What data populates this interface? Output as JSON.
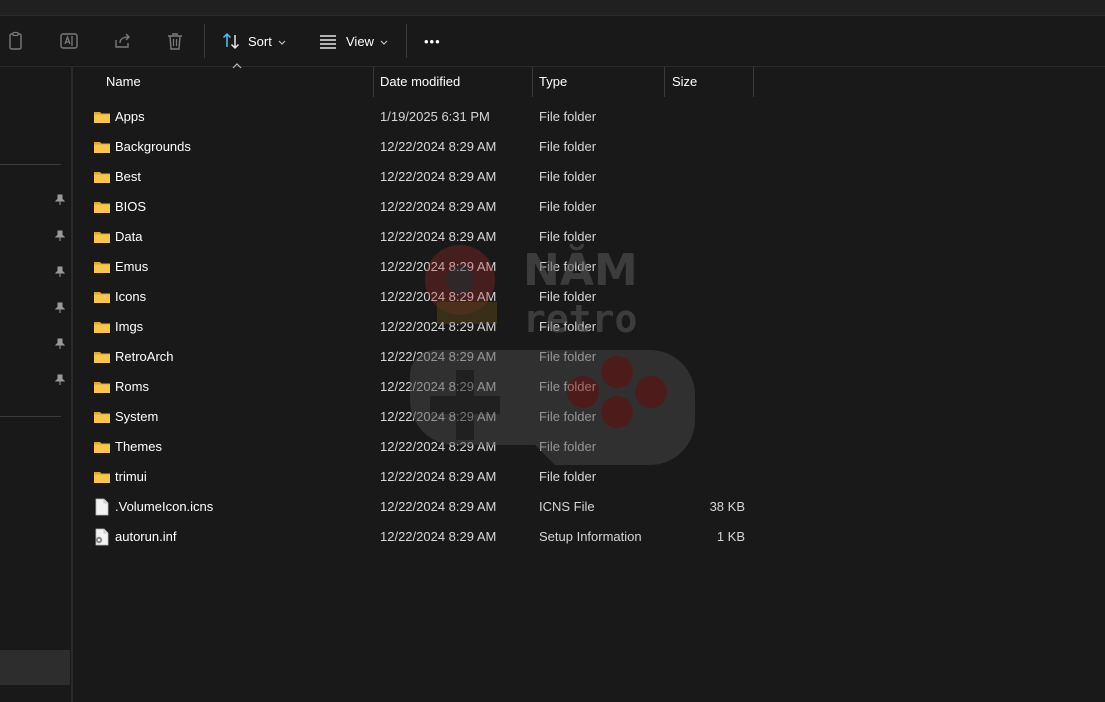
{
  "toolbar": {
    "copy_icon": "clipboard-icon",
    "rename_icon": "rename-icon",
    "share_icon": "share-icon",
    "delete_icon": "trash-icon",
    "sort_label": "Sort",
    "view_label": "View",
    "more_label": "•••"
  },
  "columns": {
    "name": "Name",
    "date": "Date modified",
    "type": "Type",
    "size": "Size"
  },
  "files": [
    {
      "name": "Apps",
      "date": "1/19/2025 6:31 PM",
      "type": "File folder",
      "size": "",
      "icon": "folder-icon"
    },
    {
      "name": "Backgrounds",
      "date": "12/22/2024 8:29 AM",
      "type": "File folder",
      "size": "",
      "icon": "folder-icon"
    },
    {
      "name": "Best",
      "date": "12/22/2024 8:29 AM",
      "type": "File folder",
      "size": "",
      "icon": "folder-icon"
    },
    {
      "name": "BIOS",
      "date": "12/22/2024 8:29 AM",
      "type": "File folder",
      "size": "",
      "icon": "folder-icon"
    },
    {
      "name": "Data",
      "date": "12/22/2024 8:29 AM",
      "type": "File folder",
      "size": "",
      "icon": "folder-icon"
    },
    {
      "name": "Emus",
      "date": "12/22/2024 8:29 AM",
      "type": "File folder",
      "size": "",
      "icon": "folder-icon"
    },
    {
      "name": "Icons",
      "date": "12/22/2024 8:29 AM",
      "type": "File folder",
      "size": "",
      "icon": "folder-icon"
    },
    {
      "name": "Imgs",
      "date": "12/22/2024 8:29 AM",
      "type": "File folder",
      "size": "",
      "icon": "folder-icon"
    },
    {
      "name": "RetroArch",
      "date": "12/22/2024 8:29 AM",
      "type": "File folder",
      "size": "",
      "icon": "folder-icon"
    },
    {
      "name": "Roms",
      "date": "12/22/2024 8:29 AM",
      "type": "File folder",
      "size": "",
      "icon": "folder-icon"
    },
    {
      "name": "System",
      "date": "12/22/2024 8:29 AM",
      "type": "File folder",
      "size": "",
      "icon": "folder-icon"
    },
    {
      "name": "Themes",
      "date": "12/22/2024 8:29 AM",
      "type": "File folder",
      "size": "",
      "icon": "folder-icon"
    },
    {
      "name": "trimui",
      "date": "12/22/2024 8:29 AM",
      "type": "File folder",
      "size": "",
      "icon": "folder-icon"
    },
    {
      "name": ".VolumeIcon.icns",
      "date": "12/22/2024 8:29 AM",
      "type": "ICNS File",
      "size": "38 KB",
      "icon": "file-icon"
    },
    {
      "name": "autorun.inf",
      "date": "12/22/2024 8:29 AM",
      "type": "Setup Information",
      "size": "1 KB",
      "icon": "settings-file-icon"
    }
  ],
  "watermark": {
    "line1": "NĂM",
    "line2": "retro"
  },
  "colors": {
    "background": "#191919",
    "folder": "#f8c64a",
    "accent": "#4cc2ff"
  }
}
